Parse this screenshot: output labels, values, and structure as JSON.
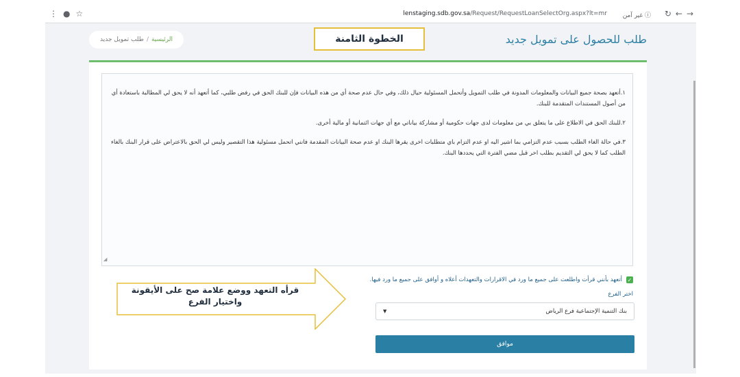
{
  "browser": {
    "url_host": "lenstaging.sdb.gov.sa",
    "url_path": "/Request/RequestLoanSelectOrg.aspx?lt=mr",
    "security": "غير آمن"
  },
  "header": {
    "title": "طلب للحصول على تمويل جديد",
    "step_label": "الخطوة الثامنة"
  },
  "breadcrumb": {
    "home": "الرئيسية",
    "separator": "/",
    "current": "طلب تمويل جديد"
  },
  "terms": {
    "items": [
      "١.أتعهد بصحة جميع البيانات والمعلومات المدونة في طلب التمويل وأتحمل المسئولية حيال ذلك، وفي حال عدم صحة أي من هذه البيانات فإن للبنك الحق في رفض طلبي، كما أتعهد أنه لا يحق لي المطالبة باستعادة أي من أصول المستندات المتقدمة للبنك.",
      "٢.للبنك الحق في الاطلاع على ما يتعلق بي من معلومات لدى جهات حكومية أو مشاركة بياناتي مع أي جهات ائتمانية أو مالية أخرى.",
      "٣.في حالة الغاء الطلب بسبب عدم التزامي بما اشير اليه او عدم التزام باي متطلبات اخرى يقرها البنك او عدم صحة البيانات المقدمة فانني اتحمل مسئولية هذا التقصير وليس لي الحق بالاعتراض على قرار البنك بالغاء الطلب كما لا يحق لي التقديم بطلب اخر قبل مضي الفترة التي يحددها البنك."
    ]
  },
  "form": {
    "agree_text": "أتعهد بأنني قرأت واطلعت على جميع ما ورد في الاقرارات والتعهدات أعلاه و أوافق على جميع ما ورد فيها.",
    "agree_checked": true,
    "branch_label": "اختر الفرع",
    "branch_value": "بنك التنمية الإجتماعية فرع الرياض",
    "submit_label": "موافق"
  },
  "annotation": {
    "text": "قرأه التعهد ووضع علامة صح على الأيقونة واختيار الفرع"
  },
  "colors": {
    "accent": "#2a7fa5",
    "step_border": "#e5bf3a",
    "card_top": "#6cbd6c"
  }
}
